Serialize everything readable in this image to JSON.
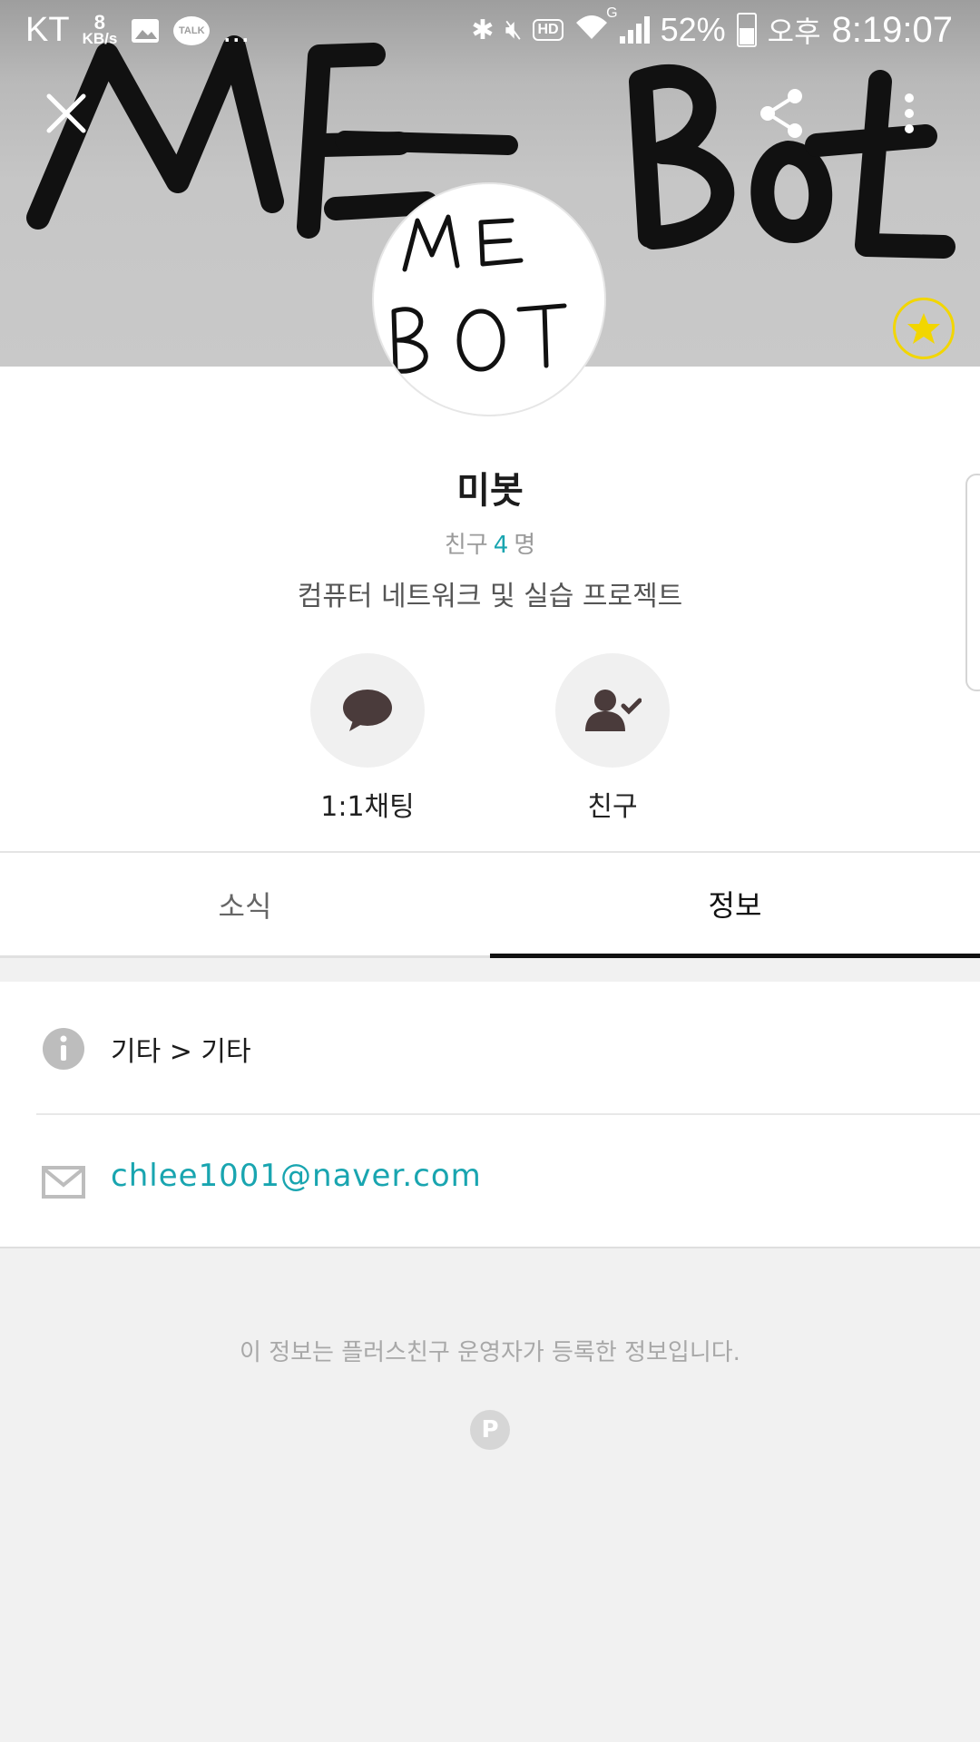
{
  "status_bar": {
    "carrier": "KT",
    "net_speed_value": "8",
    "net_speed_unit": "KB/s",
    "overflow": "...",
    "talk_badge": "TALK",
    "hd_label": "HD",
    "network_type": "G",
    "battery_percent": "52%",
    "ampm": "오후",
    "time": "8:19:07",
    "battery_level": 0.52
  },
  "cover": {
    "handwriting_text": "ME Bot"
  },
  "profile": {
    "avatar_text_line1": "ME",
    "avatar_text_line2": "BOT",
    "name": "미봇",
    "friends_prefix": "친구",
    "friends_count": "4",
    "friends_suffix": "명",
    "description": "컴퓨터 네트워크 및 실습 프로젝트"
  },
  "actions": {
    "chat_label": "1:1채팅",
    "friend_label": "친구"
  },
  "tabs": {
    "news_label": "소식",
    "info_label": "정보",
    "active": "정보"
  },
  "info": {
    "category": "기타 > 기타",
    "email": "chlee1001@naver.com"
  },
  "footer": {
    "note": "이 정보는 플러스친구 운영자가 등록한 정보입니다.",
    "logo_letter": "P"
  },
  "colors": {
    "accent": "#19a5b0",
    "star": "#f2d600",
    "icon_brown": "#4a3b3b"
  },
  "icons": [
    "close-icon",
    "share-icon",
    "more-icon",
    "star-icon",
    "chat-bubble-icon",
    "friend-check-icon",
    "info-icon",
    "mail-icon",
    "plus-friend-logo"
  ]
}
